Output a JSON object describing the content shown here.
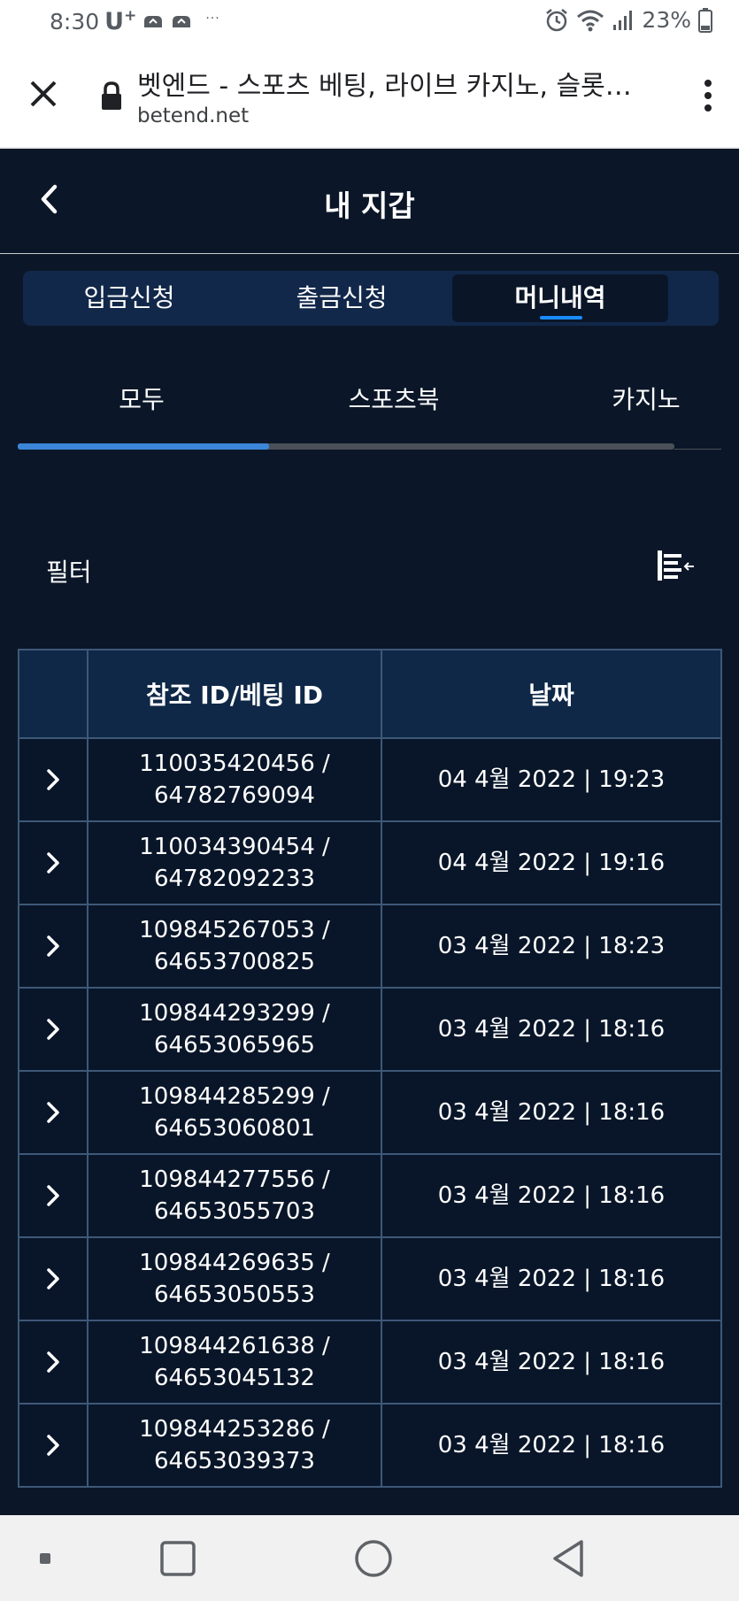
{
  "status_bar": {
    "time": "8:30",
    "carrier": "U",
    "carrier_plus": "+",
    "notification_dots": "···",
    "battery": "23%"
  },
  "browser": {
    "title": "벳엔드 - 스포츠 베팅, 라이브 카지노, 슬롯…",
    "url": "betend.net"
  },
  "header": {
    "title": "내 지갑"
  },
  "main_tabs": [
    {
      "label": "입금신청"
    },
    {
      "label": "출금신청"
    },
    {
      "label": "머니내역"
    }
  ],
  "sub_tabs": [
    {
      "label": "모두"
    },
    {
      "label": "스포츠북"
    },
    {
      "label": "카지노"
    }
  ],
  "filter": {
    "label": "필터"
  },
  "table": {
    "headers": [
      "",
      "참조 ID/베팅 ID",
      "날짜"
    ],
    "rows": [
      {
        "ref": "110035420456 /",
        "bet": "64782769094",
        "date": "04 4월 2022 | 19:23"
      },
      {
        "ref": "110034390454 /",
        "bet": "64782092233",
        "date": "04 4월 2022 | 19:16"
      },
      {
        "ref": "109845267053 /",
        "bet": "64653700825",
        "date": "03 4월 2022 | 18:23"
      },
      {
        "ref": "109844293299 /",
        "bet": "64653065965",
        "date": "03 4월 2022 | 18:16"
      },
      {
        "ref": "109844285299 /",
        "bet": "64653060801",
        "date": "03 4월 2022 | 18:16"
      },
      {
        "ref": "109844277556 /",
        "bet": "64653055703",
        "date": "03 4월 2022 | 18:16"
      },
      {
        "ref": "109844269635 /",
        "bet": "64653050553",
        "date": "03 4월 2022 | 18:16"
      },
      {
        "ref": "109844261638 /",
        "bet": "64653045132",
        "date": "03 4월 2022 | 18:16"
      },
      {
        "ref": "109844253286 /",
        "bet": "64653039373",
        "date": "03 4월 2022 | 18:16"
      }
    ]
  },
  "colors": {
    "background": "#0b1728",
    "tab_bar": "#12284a",
    "accent": "#1a8cff",
    "table_border": "#3e5878"
  },
  "icons": {
    "browser": [
      "close-icon",
      "lock-icon",
      "kebab-menu-icon"
    ],
    "header": [
      "back-arrow-icon"
    ],
    "filter": "filter-collapse-icon",
    "row": "chevron-right-icon",
    "nav": [
      "recents-dot-icon",
      "square-icon",
      "home-circle-icon",
      "back-triangle-icon"
    ]
  }
}
